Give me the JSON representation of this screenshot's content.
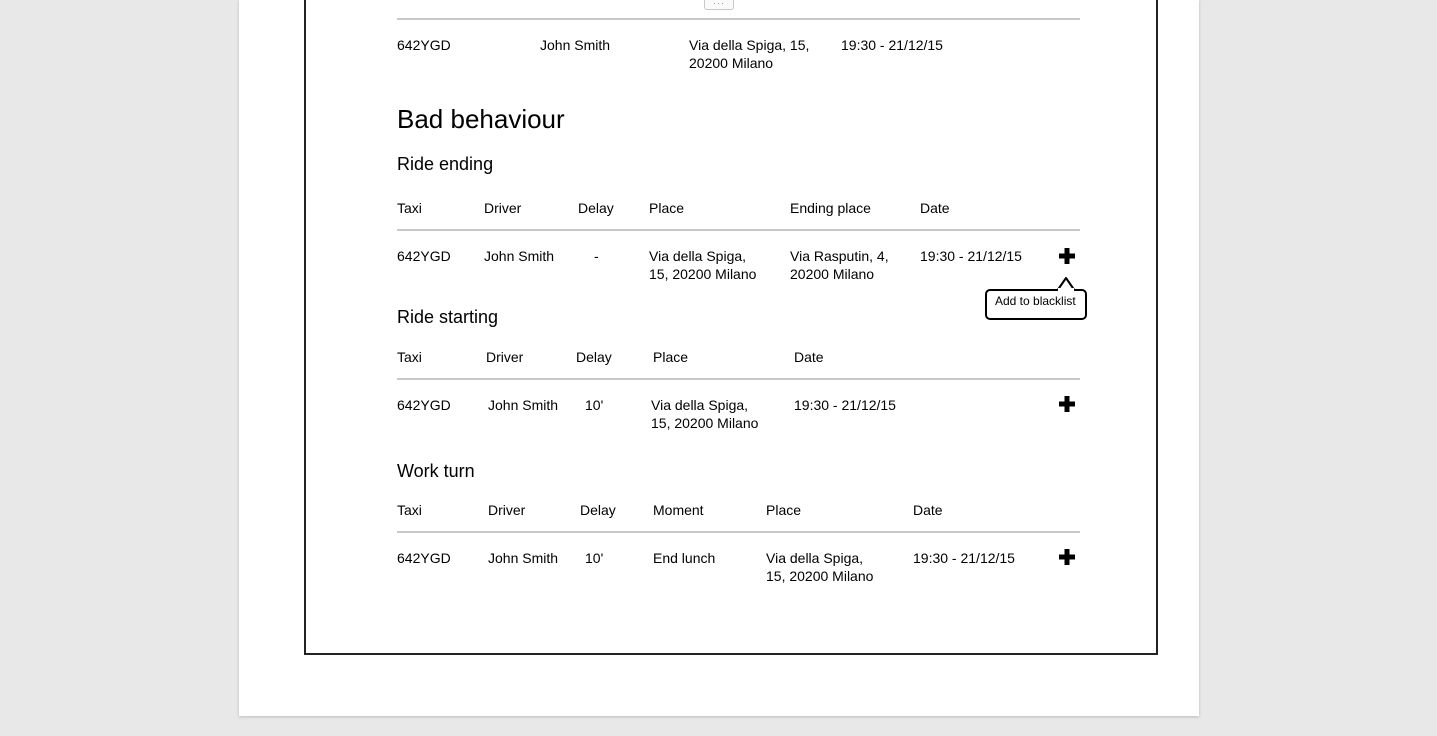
{
  "top_row": {
    "taxi": "642YGD",
    "driver": "John Smith",
    "place": "Via della Spiga, 15, 20200 Milano",
    "date": "19:30 - 21/12/15"
  },
  "section_title": "Bad behaviour",
  "ride_ending": {
    "title": "Ride ending",
    "headers": [
      "Taxi",
      "Driver",
      "Delay",
      "Place",
      "Ending place",
      "Date"
    ],
    "row": {
      "taxi": "642YGD",
      "driver": "John Smith",
      "delay": "-",
      "place": "Via della Spiga, 15, 20200 Milano",
      "ending_place": "Via Rasputin, 4, 20200 Milano",
      "date": "19:30 - 21/12/15"
    }
  },
  "ride_starting": {
    "title": "Ride starting",
    "headers": [
      "Taxi",
      "Driver",
      "Delay",
      "Place",
      "Date"
    ],
    "row": {
      "taxi": "642YGD",
      "driver": "John Smith",
      "delay": "10'",
      "place": "Via della Spiga, 15, 20200 Milano",
      "date": "19:30 - 21/12/15"
    }
  },
  "work_turn": {
    "title": "Work turn",
    "headers": [
      "Taxi",
      "Driver",
      "Delay",
      "Moment",
      "Place",
      "Date"
    ],
    "row": {
      "taxi": "642YGD",
      "driver": "John Smith",
      "delay": "10'",
      "moment": "End lunch",
      "place": "Via della Spiga, 15, 20200 Milano",
      "date": "19:30 - 21/12/15"
    }
  },
  "tooltip": {
    "text": "Add to blacklist"
  },
  "icons": {
    "add": "plus-icon",
    "handle": "ellipsis-icon"
  },
  "handle_glyph": "···"
}
